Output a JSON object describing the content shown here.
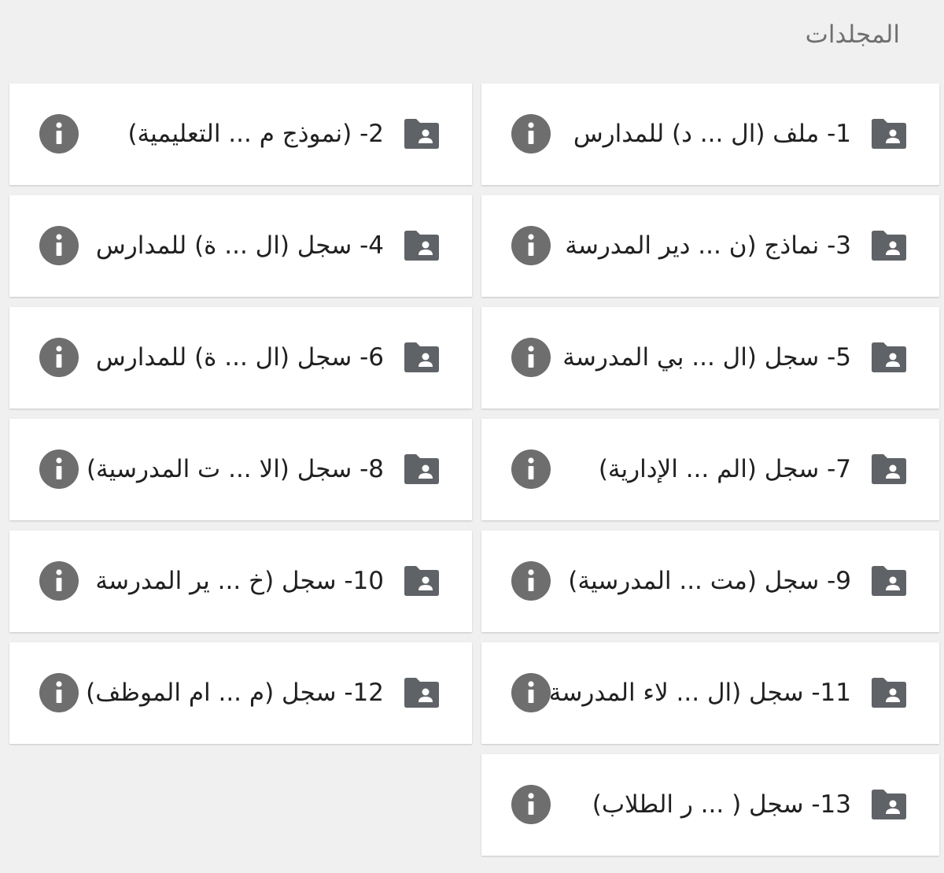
{
  "header": {
    "title": "المجلدات"
  },
  "folders": [
    {
      "label": "1- ملف (ال ... د) للمدارس"
    },
    {
      "label": "2- (نموذج م ... التعليمية)"
    },
    {
      "label": "3- نماذج (ن ... دير المدرسة"
    },
    {
      "label": "4- سجل (ال ... ة) للمدارس"
    },
    {
      "label": "5- سجل (ال ... بي المدرسة"
    },
    {
      "label": "6- سجل (ال ... ة) للمدارس"
    },
    {
      "label": "7- سجل (الم ... الإدارية)"
    },
    {
      "label": "8- سجل (الا ... ت المدرسية)"
    },
    {
      "label": "9- سجل (مت ... المدرسية)"
    },
    {
      "label": "10- سجل (خ ... ير المدرسة"
    },
    {
      "label": "11- سجل (ال ... لاء المدرسة"
    },
    {
      "label": "12- سجل (م ... ام الموظف)"
    },
    {
      "label": "13- سجل ( ... ر الطلاب)"
    }
  ],
  "icons": {
    "folder": "shared-folder-icon",
    "info": "info-icon"
  },
  "colors": {
    "background": "#f0f0f0",
    "card": "#ffffff",
    "icon": "#5f6368",
    "info_circle": "#6e6e6e",
    "title_text": "#6f6f6f",
    "label_text": "#202020"
  }
}
